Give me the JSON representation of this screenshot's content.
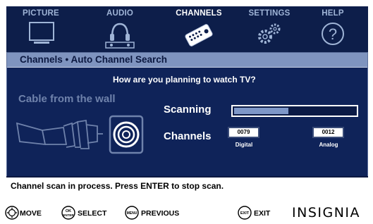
{
  "menu": {
    "tabs": [
      {
        "label": "PICTURE",
        "icon": "tv-icon",
        "active": false
      },
      {
        "label": "AUDIO",
        "icon": "headphones-speaker-icon",
        "active": false
      },
      {
        "label": "CHANNELS",
        "icon": "remote-control-icon",
        "active": true
      },
      {
        "label": "SETTINGS",
        "icon": "gears-icon",
        "active": false
      },
      {
        "label": "HELP",
        "icon": "question-icon",
        "active": false
      }
    ]
  },
  "panel": {
    "title": "Channels • Auto Channel Search",
    "question": "How are you planning to watch TV?",
    "source_label": "Cable from the wall",
    "scanning_label": "Scanning",
    "scan_progress": 0.45,
    "channels_label": "Channels",
    "digital": {
      "value": "0079",
      "caption": "Digital"
    },
    "analog": {
      "value": "0012",
      "caption": "Analog"
    }
  },
  "status": {
    "message": "Channel scan in process. Press ENTER to stop scan."
  },
  "hints": {
    "move": {
      "key": "",
      "label": "MOVE"
    },
    "select": {
      "key_top": "OK",
      "key_bottom": "ENTER",
      "label": "SELECT"
    },
    "previous": {
      "key": "MENU",
      "label": "PREVIOUS"
    },
    "exit": {
      "key": "EXIT",
      "label": "EXIT"
    }
  },
  "brand": "INSIGNIA",
  "colors": {
    "menu_bg": "#0d1e4a",
    "panel_bg": "#0f2359",
    "header_bg": "#7f94bf",
    "scan_fill": "#7e97c8"
  }
}
